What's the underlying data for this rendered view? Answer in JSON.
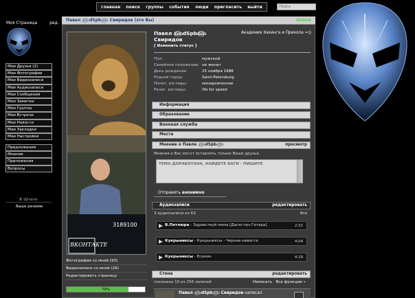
{
  "topnav": {
    "items": [
      "главная",
      "поиск",
      "группы",
      "события",
      "люди",
      "пригласить",
      "выйти"
    ]
  },
  "search": {
    "placeholder": "Поиск"
  },
  "sidebar": {
    "my_page": "Моя Страница",
    "edit": "ред.",
    "items_a": [
      "Мои Друзья (2)",
      "Мои Фотографии",
      "Мои Видеозаписи",
      "Мои Аудиозаписи",
      "Мои Сообщения",
      "Мои Заметки",
      "Мои Группы",
      "Мои Встречи",
      "Мои Новости",
      "Мои Закладки",
      "Мои Настройки"
    ],
    "items_b": [
      "Предложения",
      "Мнения",
      "Приложения",
      "Вопросы"
    ],
    "vstate": "В Штате",
    "vashe": "Ваше резюме"
  },
  "header": {
    "title": "Павел ௵dSpb௵ Свиридов (это Вы)",
    "online": "Online"
  },
  "photo": {
    "counter": "3189100",
    "watermark": "ВКОНТАКТЕ"
  },
  "leftlinks": [
    "Фотографии со мной (93)",
    "Видеозаписи со мной (26)",
    "Редактировать страницу"
  ],
  "progress": {
    "value": 0.79,
    "label": "79%"
  },
  "profile": {
    "name_line1": "Павел ௵dSpb௵",
    "name_line2": "Свиридов",
    "status_btn": "[ Изменить статус ]",
    "university": "Академия Хакинга и Прикола =))",
    "info": [
      {
        "k": "Пол:",
        "v": "мужской"
      },
      {
        "k": "Семейное положение:",
        "v": "не женат"
      },
      {
        "k": "День рождения:",
        "v": "25 ноября 1988"
      },
      {
        "k": "Родной город:",
        "v": "Saint-Petersburg"
      },
      {
        "k": "Полит. взгляды:",
        "v": "монархические"
      },
      {
        "k": "Религ. взгляды:",
        "v": "life for speed"
      }
    ]
  },
  "sections": {
    "information": "Информация",
    "education": "Образование",
    "military": "Военная служба",
    "places": "Места",
    "opinion": "Мнение о Павле ௵dSpb௵",
    "opinion_view": "просмотр",
    "opinion_note": "Мнения о Вас могут оставлять только Ваши друзья.",
    "textarea_text": "ТЕМА ДОРАБОТАНА, НАЙДЕТЕ БАГИ - ПИШИТЕ",
    "send_prefix": "Отправить ",
    "send_bold": "анонимно",
    "audio": "Аудиозаписи",
    "audio_edit": "редактировать",
    "audio_count": "3 аудиозаписи из 63.",
    "audio_all": "Все",
    "wall": "Стена",
    "wall_edit": "редактировать",
    "wall_meta": "показаны 10 из 256 записей",
    "wall_write": "Написать",
    "wall_funcs": "Все функции »"
  },
  "tracks": [
    {
      "artist": "В.Петлюра",
      "title": " - Здравствуй мама [Дагестан.Гитара]",
      "time": "2:32"
    },
    {
      "artist": "Кукрыниксы",
      "title": " - Кукрыниксы - Черная невеста",
      "time": "4:04"
    },
    {
      "artist": "Кукрыниксы",
      "title": " - Есенин",
      "time": "4:18"
    }
  ],
  "post": {
    "author": "Павел ௵dSpb௵ Свиридов",
    "action": " написал"
  }
}
